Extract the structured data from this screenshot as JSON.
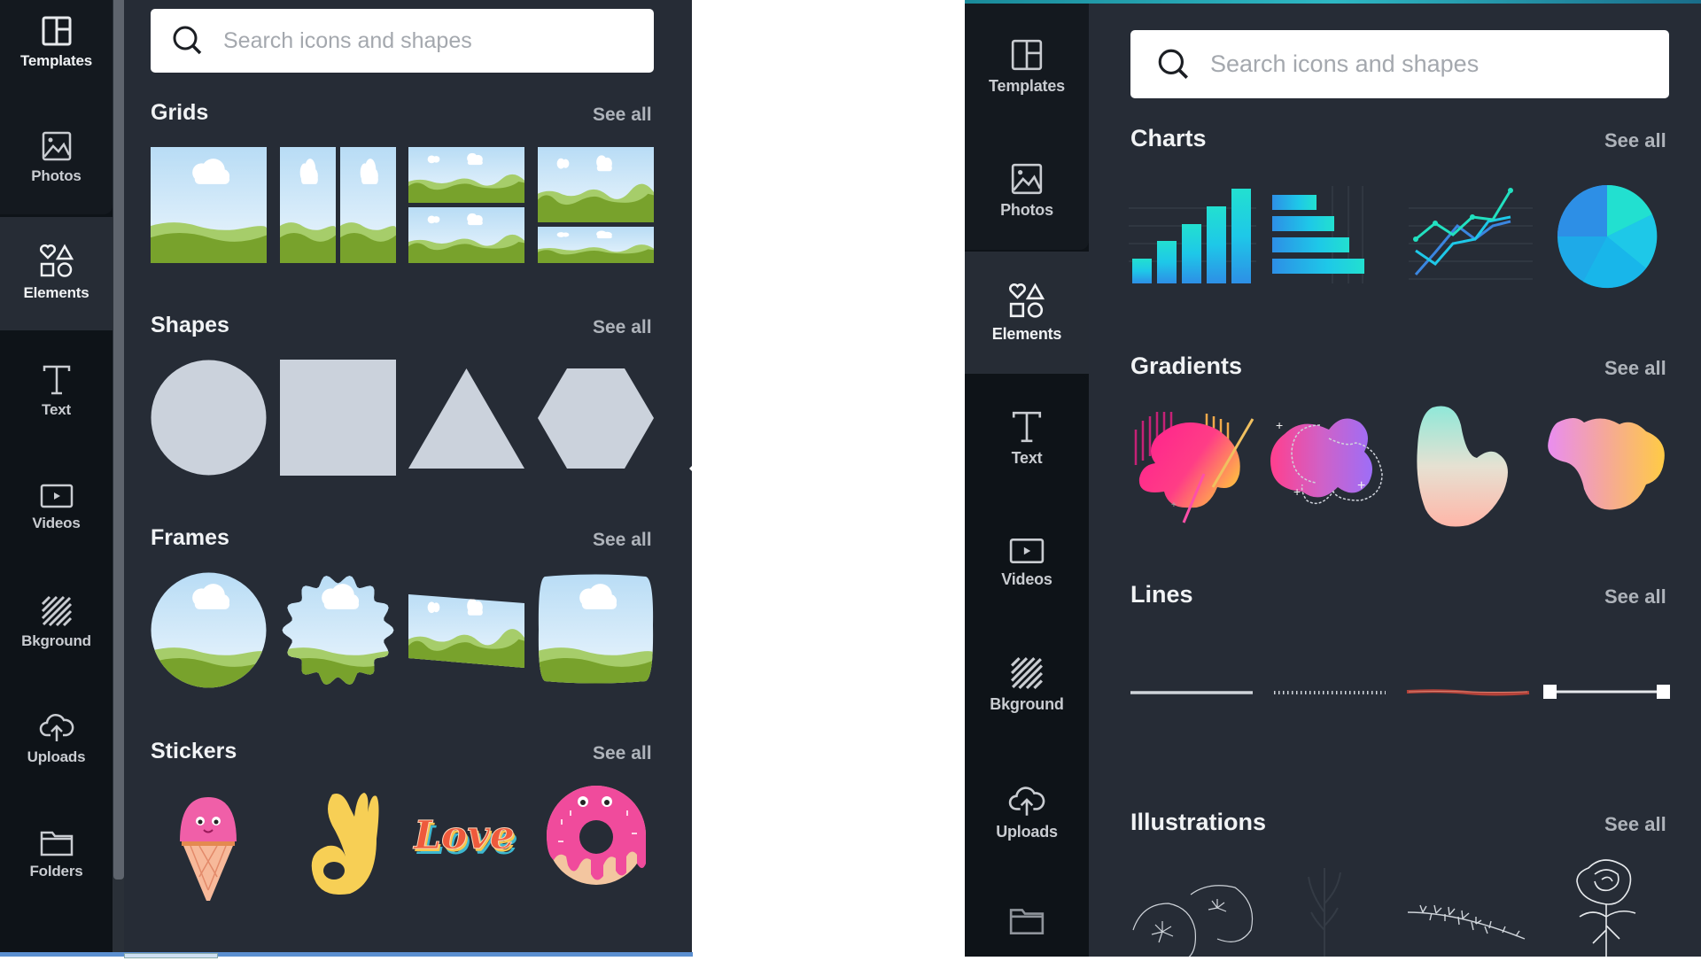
{
  "left_panel": {
    "sidebar": {
      "items": [
        {
          "label": "Templates",
          "icon": "templates-icon",
          "active": false
        },
        {
          "label": "Photos",
          "icon": "photos-icon",
          "active": false
        },
        {
          "label": "Elements",
          "icon": "elements-icon",
          "active": true
        },
        {
          "label": "Text",
          "icon": "text-icon",
          "active": false
        },
        {
          "label": "Videos",
          "icon": "videos-icon",
          "active": false
        },
        {
          "label": "Bkground",
          "icon": "background-icon",
          "active": false
        },
        {
          "label": "Uploads",
          "icon": "uploads-icon",
          "active": false
        },
        {
          "label": "Folders",
          "icon": "folders-icon",
          "active": false
        }
      ]
    },
    "search": {
      "placeholder": "Search icons and shapes",
      "value": ""
    },
    "sections": [
      {
        "title": "Grids",
        "see_all": "See all",
        "items": [
          "grid-single",
          "grid-two-columns",
          "grid-two-rows",
          "grid-large-top-small-bottom"
        ]
      },
      {
        "title": "Shapes",
        "see_all": "See all",
        "items": [
          "circle",
          "square",
          "triangle",
          "hexagon"
        ]
      },
      {
        "title": "Frames",
        "see_all": "See all",
        "items": [
          "circle-frame",
          "scalloped-frame",
          "skewed-frame",
          "rounded-frame"
        ]
      },
      {
        "title": "Stickers",
        "see_all": "See all",
        "items": [
          "ice-cream-sticker",
          "ok-hand-sticker",
          "love-sticker",
          "donut-sticker"
        ]
      }
    ],
    "love_sticker_text": "Love"
  },
  "right_panel": {
    "sidebar": {
      "items": [
        {
          "label": "Templates",
          "icon": "templates-icon",
          "active": false
        },
        {
          "label": "Photos",
          "icon": "photos-icon",
          "active": false
        },
        {
          "label": "Elements",
          "icon": "elements-icon",
          "active": true
        },
        {
          "label": "Text",
          "icon": "text-icon",
          "active": false
        },
        {
          "label": "Videos",
          "icon": "videos-icon",
          "active": false
        },
        {
          "label": "Bkground",
          "icon": "background-icon",
          "active": false
        },
        {
          "label": "Uploads",
          "icon": "uploads-icon",
          "active": false
        },
        {
          "label": "",
          "icon": "folders-icon",
          "active": false
        }
      ]
    },
    "search": {
      "placeholder": "Search icons and shapes",
      "value": ""
    },
    "sections": [
      {
        "title": "Charts",
        "see_all": "See all",
        "items": [
          "bar-chart",
          "horizontal-bar-chart",
          "line-chart",
          "pie-chart"
        ]
      },
      {
        "title": "Gradients",
        "see_all": "See all",
        "items": [
          "pink-orange-blob",
          "pink-purple-blob",
          "mint-peach-blob",
          "violet-yellow-blob"
        ]
      },
      {
        "title": "Lines",
        "see_all": "See all",
        "items": [
          "solid-line",
          "dotted-line",
          "brush-line",
          "line-with-endpoints"
        ]
      },
      {
        "title": "Illustrations",
        "see_all": "See all",
        "items": [
          "flowers-illustration",
          "plant-illustration",
          "branch-illustration",
          "rose-illustration"
        ]
      }
    ]
  },
  "colors": {
    "sidebar_bg": "#0e1318",
    "panel_bg": "#262c36",
    "shape_fill": "#cbd2dc",
    "chart_blue": "#2d8fe6",
    "chart_cyan": "#1ec8e8",
    "chart_teal": "#22e0d0",
    "accent_top": "#2eb8c4"
  }
}
